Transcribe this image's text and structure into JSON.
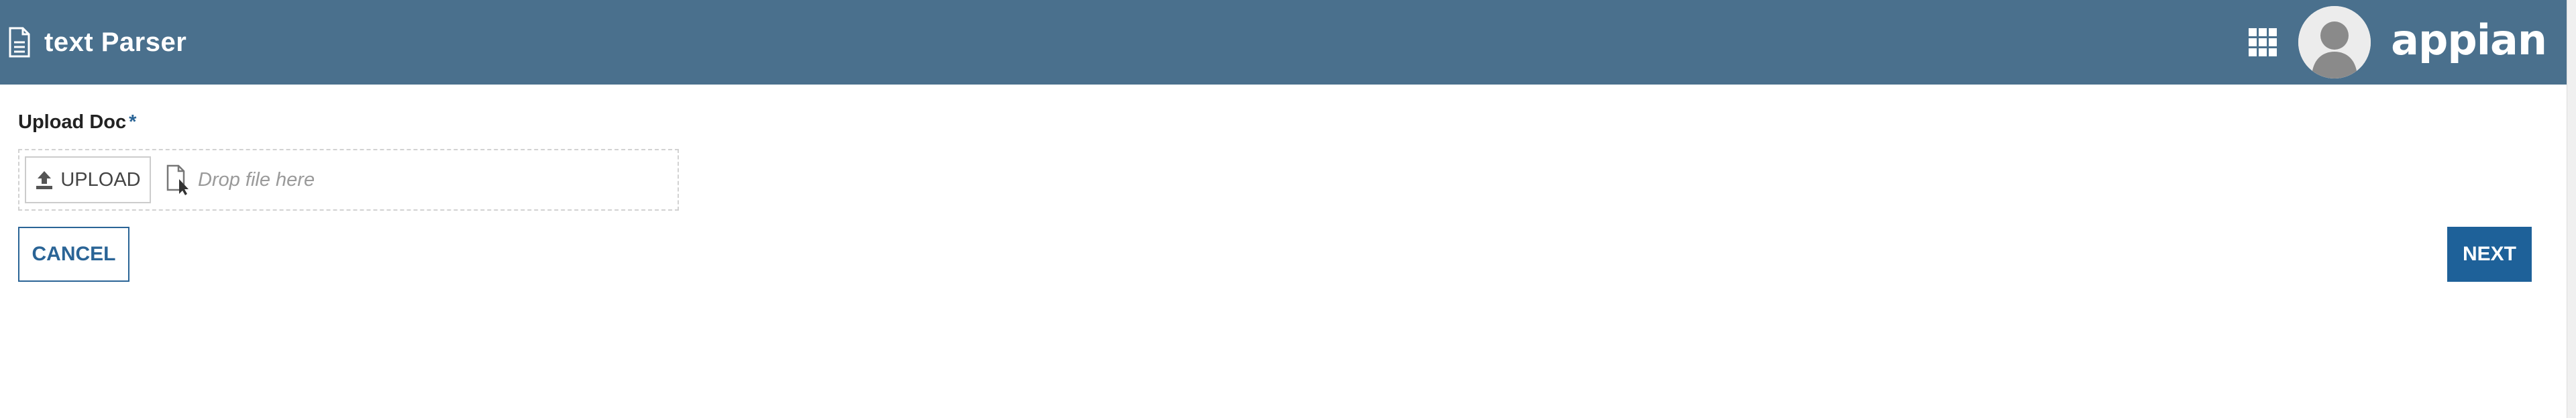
{
  "header": {
    "title": "text Parser",
    "brand": "appian",
    "icons": {
      "title_icon": "document-icon",
      "apps": "app-grid-icon",
      "avatar": "user-avatar-icon"
    }
  },
  "form": {
    "upload_field": {
      "label": "Upload Doc",
      "required_marker": "*",
      "upload_button_label": "UPLOAD",
      "drop_placeholder": "Drop file here",
      "icons": {
        "upload": "upload-arrow-icon",
        "drop": "file-drop-icon"
      }
    },
    "buttons": {
      "cancel_label": "CANCEL",
      "next_label": "NEXT"
    }
  },
  "colors": {
    "header_bg": "#4a708d",
    "accent": "#2a6496",
    "primary_button": "#1e6199"
  }
}
